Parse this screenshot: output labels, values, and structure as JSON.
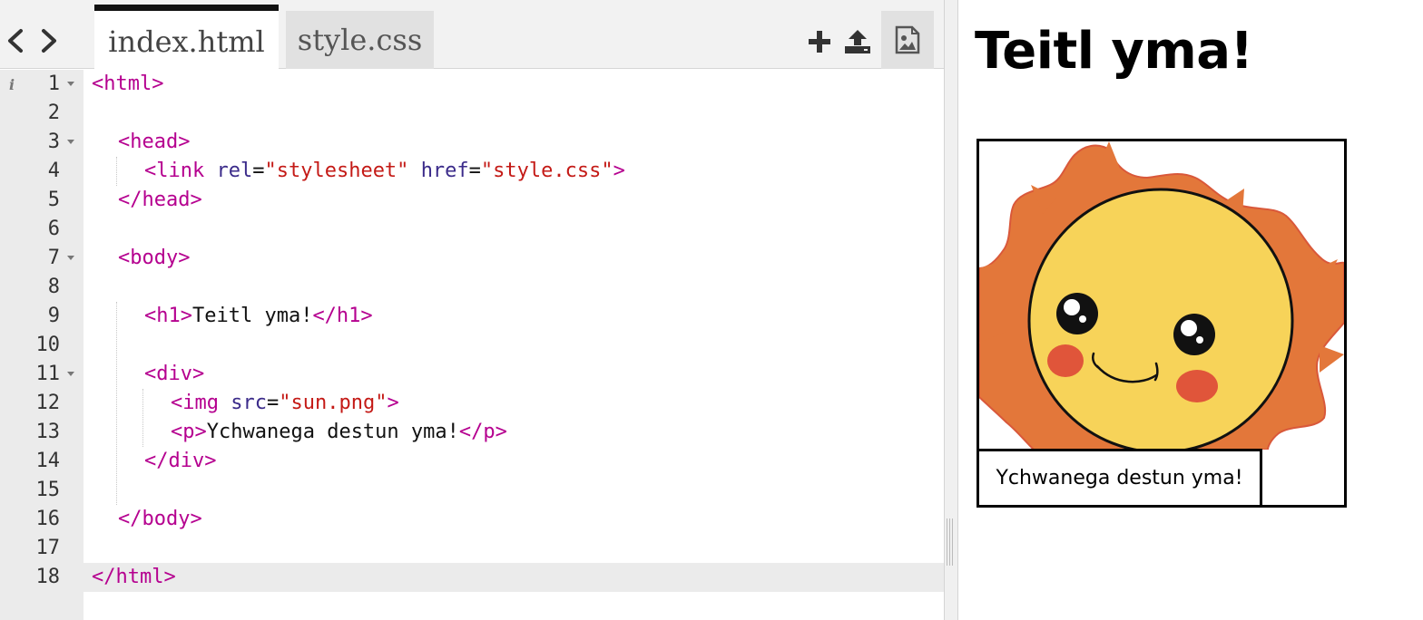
{
  "editor": {
    "tabs": [
      {
        "label": "index.html",
        "active": true
      },
      {
        "label": "style.css",
        "active": false
      }
    ],
    "toolbar": {
      "back_icon": "chevron-left-icon",
      "forward_icon": "chevron-right-icon",
      "add_icon": "plus-icon",
      "upload_icon": "upload-icon",
      "image_icon": "image-icon"
    },
    "line_numbers": [
      "1",
      "2",
      "3",
      "4",
      "5",
      "6",
      "7",
      "8",
      "9",
      "10",
      "11",
      "12",
      "13",
      "14",
      "15",
      "16",
      "17",
      "18"
    ],
    "active_line": "18",
    "code": {
      "l1_tag": "<html>",
      "l3_tag": "<head>",
      "l4_open": "<link",
      "l4_attr1": "rel",
      "l4_eq1": "=",
      "l4_val1": "\"stylesheet\"",
      "l4_attr2": "href",
      "l4_eq2": "=",
      "l4_val2": "\"style.css\"",
      "l4_close": ">",
      "l5_tag": "</head>",
      "l7_tag": "<body>",
      "l9_open": "<h1>",
      "l9_text": "Teitl yma!",
      "l9_close": "</h1>",
      "l11_tag": "<div>",
      "l12_open": "<img",
      "l12_attr": "src",
      "l12_eq": "=",
      "l12_val": "\"sun.png\"",
      "l12_close": ">",
      "l13_open": "<p>",
      "l13_text": "Ychwanega destun yma!",
      "l13_close": "</p>",
      "l14_tag": "</div>",
      "l16_tag": "</body>",
      "l18_tag": "</html>"
    },
    "colors": {
      "tag": "#b5008f",
      "attr": "#3b2b8a",
      "string": "#c41a16"
    }
  },
  "preview": {
    "title": "Teitl yma!",
    "caption": "Ychwanega destun yma!",
    "image_icon": "sun-image"
  }
}
